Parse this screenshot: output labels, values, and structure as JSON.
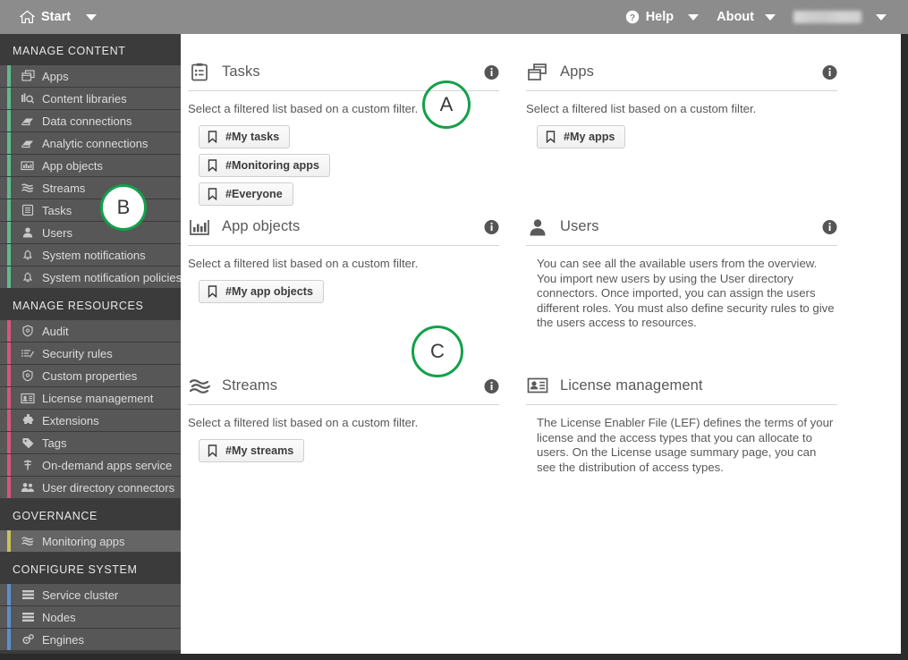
{
  "topbar": {
    "start_label": "Start",
    "home_icon": "home-icon",
    "start_caret_icon": "chevron-down-icon",
    "help_label": "Help",
    "help_icon": "help-circle-icon",
    "help_caret_icon": "chevron-down-icon",
    "about_label": "About",
    "about_caret_icon": "chevron-down-icon",
    "user_label": "",
    "user_caret_icon": "chevron-down-icon",
    "background_color": "#8c8c8c"
  },
  "sidebar": {
    "background_color": "#3b3b3b",
    "item_color": "#575757",
    "sections": [
      {
        "title": "MANAGE CONTENT",
        "accent": "#5cbb8e",
        "items": [
          {
            "label": "Apps",
            "icon": "apps-icon",
            "selected": false
          },
          {
            "label": "Content libraries",
            "icon": "content-libraries-icon",
            "selected": false
          },
          {
            "label": "Data connections",
            "icon": "data-connections-icon",
            "selected": false
          },
          {
            "label": "Analytic connections",
            "icon": "analytic-connections-icon",
            "selected": false
          },
          {
            "label": "App objects",
            "icon": "app-objects-icon",
            "selected": false
          },
          {
            "label": "Streams",
            "icon": "streams-icon",
            "selected": false
          },
          {
            "label": "Tasks",
            "icon": "tasks-icon",
            "selected": false
          },
          {
            "label": "Users",
            "icon": "users-icon",
            "selected": false
          },
          {
            "label": "System notifications",
            "icon": "bell-icon",
            "selected": false
          },
          {
            "label": "System notification policies",
            "icon": "bell-icon",
            "selected": false
          }
        ]
      },
      {
        "title": "MANAGE RESOURCES",
        "accent": "#d8557a",
        "items": [
          {
            "label": "Audit",
            "icon": "audit-icon",
            "selected": false
          },
          {
            "label": "Security rules",
            "icon": "security-rules-icon",
            "selected": false
          },
          {
            "label": "Custom properties",
            "icon": "custom-properties-icon",
            "selected": false
          },
          {
            "label": "License management",
            "icon": "license-icon",
            "selected": false
          },
          {
            "label": "Extensions",
            "icon": "extensions-icon",
            "selected": false
          },
          {
            "label": "Tags",
            "icon": "tag-icon",
            "selected": false
          },
          {
            "label": "On-demand apps service",
            "icon": "on-demand-apps-icon",
            "selected": false
          },
          {
            "label": "User directory connectors",
            "icon": "user-directory-icon",
            "selected": false
          }
        ]
      },
      {
        "title": "GOVERNANCE",
        "accent": "#c9c257",
        "items": [
          {
            "label": "Monitoring apps",
            "icon": "streams-icon",
            "selected": true
          }
        ]
      },
      {
        "title": "CONFIGURE SYSTEM",
        "accent": "#5b8fd0",
        "items": [
          {
            "label": "Service cluster",
            "icon": "cluster-icon",
            "selected": false
          },
          {
            "label": "Nodes",
            "icon": "cluster-icon",
            "selected": false
          },
          {
            "label": "Engines",
            "icon": "engines-icon",
            "selected": false
          }
        ]
      }
    ]
  },
  "panels": [
    {
      "id": "tasks",
      "title": "Tasks",
      "icon": "tasks-panel-icon",
      "has_info": true,
      "info_icon": "info-icon",
      "description": "Select a filtered list based on a custom filter.",
      "chips": [
        {
          "label": "#My tasks",
          "icon": "bookmark-icon"
        },
        {
          "label": "#Monitoring apps",
          "icon": "bookmark-icon"
        },
        {
          "label": "#Everyone",
          "icon": "bookmark-icon"
        }
      ]
    },
    {
      "id": "apps",
      "title": "Apps",
      "icon": "apps-panel-icon",
      "has_info": true,
      "info_icon": "info-icon",
      "description": "Select a filtered list based on a custom filter.",
      "chips": [
        {
          "label": "#My apps",
          "icon": "bookmark-icon"
        }
      ]
    },
    {
      "id": "app-objects",
      "title": "App objects",
      "icon": "app-objects-panel-icon",
      "has_info": true,
      "info_icon": "info-icon",
      "description": "Select a filtered list based on a custom filter.",
      "chips": [
        {
          "label": "#My app objects",
          "icon": "bookmark-icon"
        }
      ]
    },
    {
      "id": "users",
      "title": "Users",
      "icon": "users-panel-icon",
      "has_info": true,
      "info_icon": "info-icon",
      "description": "You can see all the available users from the overview. You import new users by using the User directory connectors. Once imported, you can assign the users different roles. You must also define security rules to give the users access to resources.",
      "chips": []
    },
    {
      "id": "streams",
      "title": "Streams",
      "icon": "streams-panel-icon",
      "has_info": true,
      "info_icon": "info-icon",
      "description": "Select a filtered list based on a custom filter.",
      "chips": [
        {
          "label": "#My streams",
          "icon": "bookmark-icon"
        }
      ]
    },
    {
      "id": "license-management",
      "title": "License management",
      "icon": "license-panel-icon",
      "has_info": false,
      "info_icon": "",
      "description": "The License Enabler File (LEF) defines the terms of your license and the access types that you can allocate to users. On the License usage summary page, you can see the distribution of access types.",
      "chips": []
    }
  ],
  "annotations": [
    {
      "label": "A",
      "style": "hollow",
      "color": "#13a14a"
    },
    {
      "label": "B",
      "style": "filled",
      "color": "#13a14a"
    },
    {
      "label": "C",
      "style": "hollow",
      "color": "#13a14a"
    }
  ]
}
